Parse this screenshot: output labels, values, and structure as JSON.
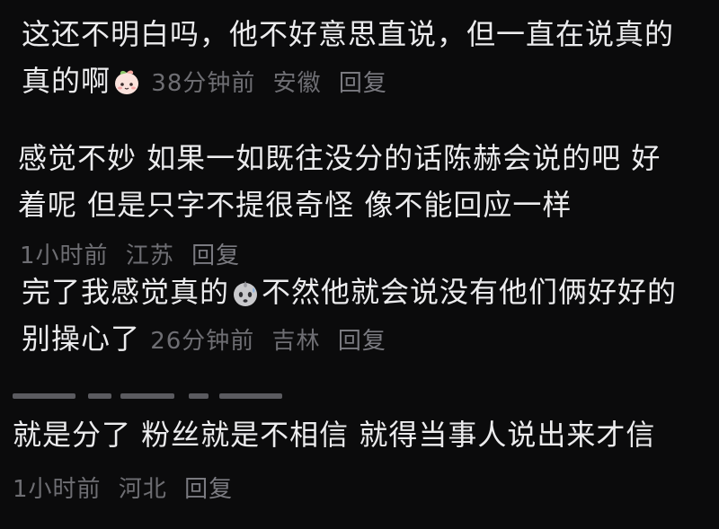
{
  "comments": [
    {
      "line1": "这还不明白吗，他不好意思直说，但一直在说真的",
      "line2": "真的啊",
      "emoji": "peach-face-emoji",
      "time": "38分钟前",
      "location": "安徽",
      "reply": "回复"
    },
    {
      "line1": "感觉不妙  如果一如既往没分的话陈赫会说的吧  好",
      "line2": "着呢  但是只字不提很奇怪  像不能回应一样",
      "time": "1小时前",
      "location": "江苏",
      "reply": "回复"
    },
    {
      "line1_before": "完了我感觉真的",
      "emoji": "sweat-face-emoji",
      "line1_after": "不然他就会说没有他们俩好好的",
      "line2": "别操心了",
      "time": "26分钟前",
      "location": "吉林",
      "reply": "回复"
    },
    {
      "line1": "就是分了 粉丝就是不相信 就得当事人说出来才信",
      "time": "1小时前",
      "location": "河北",
      "reply": "回复"
    }
  ],
  "colors": {
    "background": "#0b0b0c",
    "text": "#ececee",
    "meta": "#6e6e73"
  }
}
